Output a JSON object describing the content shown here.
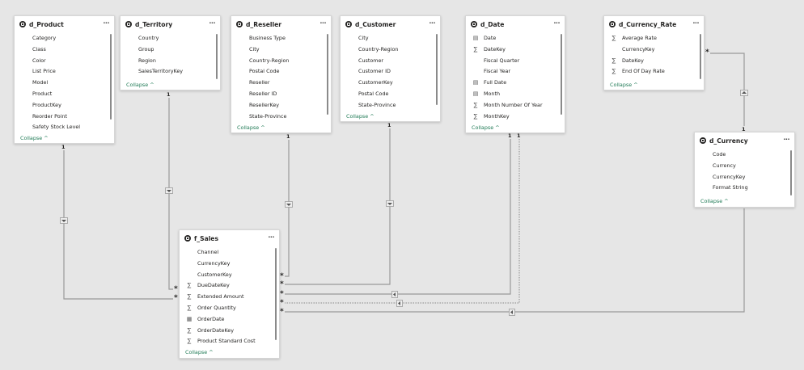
{
  "tables": {
    "d_product": {
      "title": "d_Product",
      "fields": [
        {
          "name": "Category",
          "icon": "none"
        },
        {
          "name": "Class",
          "icon": "none"
        },
        {
          "name": "Color",
          "icon": "none"
        },
        {
          "name": "List Price",
          "icon": "none"
        },
        {
          "name": "Model",
          "icon": "none"
        },
        {
          "name": "Product",
          "icon": "none"
        },
        {
          "name": "ProductKey",
          "icon": "none"
        },
        {
          "name": "Reorder Point",
          "icon": "none"
        },
        {
          "name": "Safety Stock Level",
          "icon": "none"
        }
      ],
      "collapse": "Collapse ^"
    },
    "d_territory": {
      "title": "d_Territory",
      "fields": [
        {
          "name": "Country",
          "icon": "none"
        },
        {
          "name": "Group",
          "icon": "none"
        },
        {
          "name": "Region",
          "icon": "none"
        },
        {
          "name": "SalesTerritoryKey",
          "icon": "none"
        }
      ],
      "collapse": "Collapse ^"
    },
    "d_reseller": {
      "title": "d_Reseller",
      "fields": [
        {
          "name": "Business Type",
          "icon": "none"
        },
        {
          "name": "City",
          "icon": "none"
        },
        {
          "name": "Country-Region",
          "icon": "none"
        },
        {
          "name": "Postal Code",
          "icon": "none"
        },
        {
          "name": "Reseller",
          "icon": "none"
        },
        {
          "name": "Reseller ID",
          "icon": "none"
        },
        {
          "name": "ResellerKey",
          "icon": "none"
        },
        {
          "name": "State-Province",
          "icon": "none"
        }
      ],
      "collapse": "Collapse ^"
    },
    "d_customer": {
      "title": "d_Customer",
      "fields": [
        {
          "name": "City",
          "icon": "none"
        },
        {
          "name": "Country-Region",
          "icon": "none"
        },
        {
          "name": "Customer",
          "icon": "none"
        },
        {
          "name": "Customer ID",
          "icon": "none"
        },
        {
          "name": "CustomerKey",
          "icon": "none"
        },
        {
          "name": "Postal Code",
          "icon": "none"
        },
        {
          "name": "State-Province",
          "icon": "none"
        }
      ],
      "collapse": "Collapse ^"
    },
    "d_date": {
      "title": "d_Date",
      "fields": [
        {
          "name": "Date",
          "icon": "calendar"
        },
        {
          "name": "DateKey",
          "icon": "sigma"
        },
        {
          "name": "Fiscal Quarter",
          "icon": "none"
        },
        {
          "name": "Fiscal Year",
          "icon": "none"
        },
        {
          "name": "Full Date",
          "icon": "calendar"
        },
        {
          "name": "Month",
          "icon": "calendar"
        },
        {
          "name": "Month Number Of Year",
          "icon": "sigma"
        },
        {
          "name": "MonthKey",
          "icon": "sigma"
        }
      ],
      "collapse": "Collapse ^"
    },
    "d_currency_rate": {
      "title": "d_Currency_Rate",
      "fields": [
        {
          "name": "Average Rate",
          "icon": "sigma"
        },
        {
          "name": "CurrencyKey",
          "icon": "none"
        },
        {
          "name": "DateKey",
          "icon": "sigma"
        },
        {
          "name": "End Of Day Rate",
          "icon": "sigma"
        }
      ],
      "collapse": "Collapse ^"
    },
    "d_currency": {
      "title": "d_Currency",
      "fields": [
        {
          "name": "Code",
          "icon": "none"
        },
        {
          "name": "Currency",
          "icon": "none"
        },
        {
          "name": "CurrencyKey",
          "icon": "none"
        },
        {
          "name": "Format String",
          "icon": "none"
        }
      ],
      "collapse": "Collapse ^"
    },
    "f_sales": {
      "title": "f_Sales",
      "fields": [
        {
          "name": "Channel",
          "icon": "none"
        },
        {
          "name": "CurrencyKey",
          "icon": "none"
        },
        {
          "name": "CustomerKey",
          "icon": "none"
        },
        {
          "name": "DueDateKey",
          "icon": "sigma"
        },
        {
          "name": "Extended Amount",
          "icon": "sigma"
        },
        {
          "name": "Order Quantity",
          "icon": "sigma"
        },
        {
          "name": "OrderDate",
          "icon": "calendar-hierarchy"
        },
        {
          "name": "OrderDateKey",
          "icon": "sigma"
        },
        {
          "name": "Product Standard Cost",
          "icon": "sigma"
        }
      ],
      "collapse": "Collapse ^"
    }
  },
  "more_label": "···",
  "cardinality": {
    "one": "1",
    "many": "*"
  },
  "colors": {
    "canvas": "#e6e6e6",
    "card": "#ffffff",
    "line": "#9a9a9a",
    "collapse_link": "#1f7a55"
  }
}
